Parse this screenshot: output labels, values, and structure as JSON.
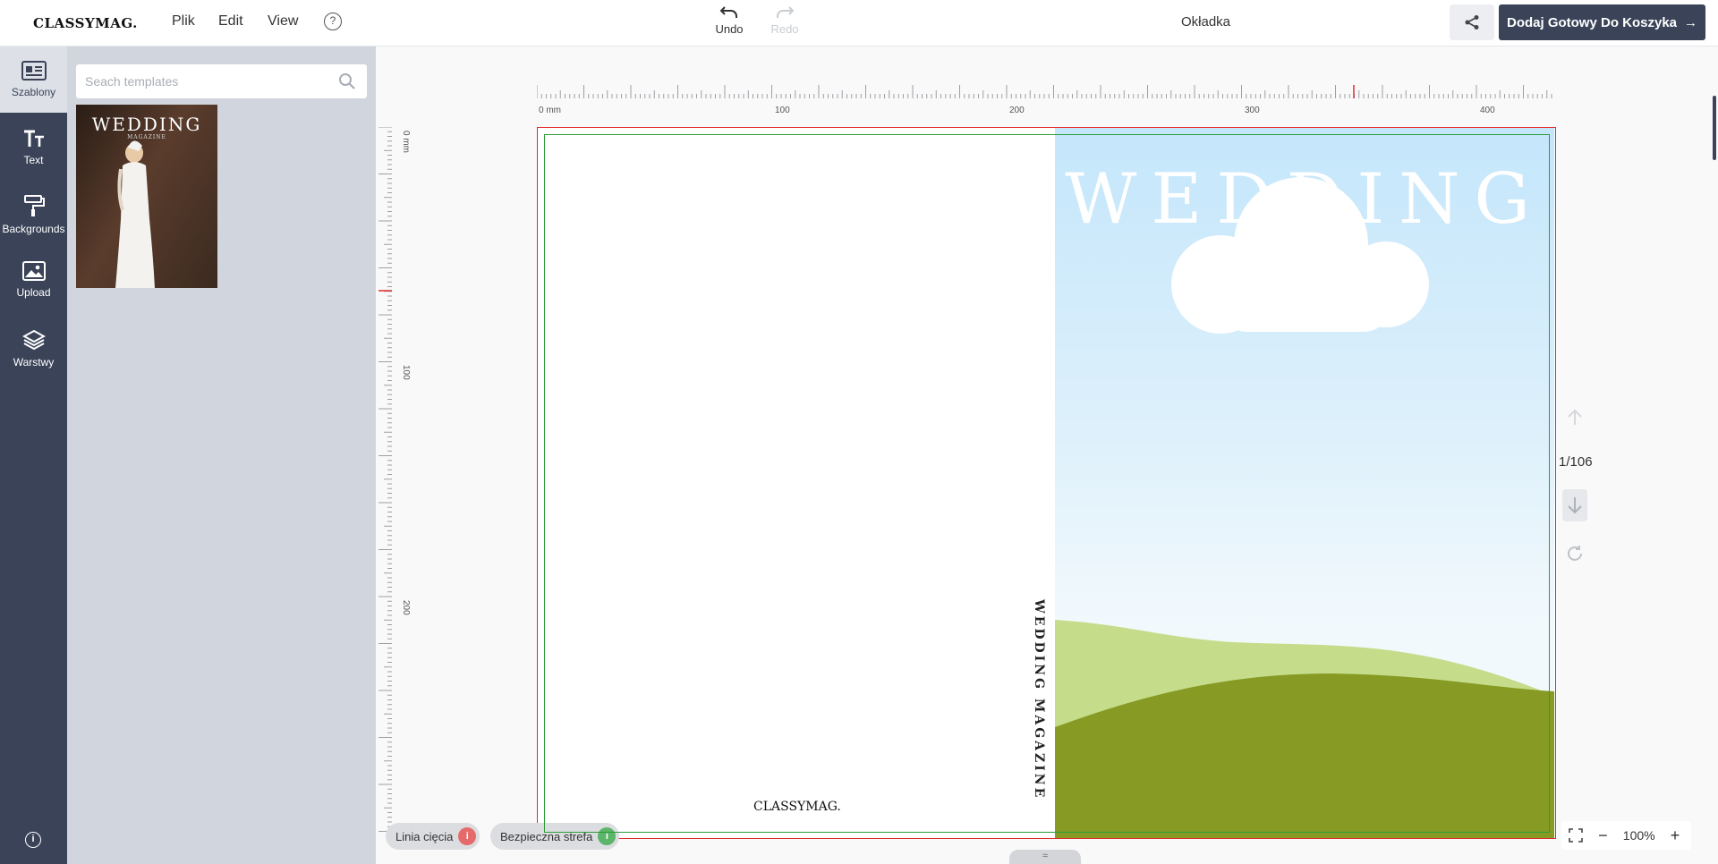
{
  "app": {
    "logo": "CLASSYMAG."
  },
  "menu": {
    "file": "Plik",
    "edit": "Edit",
    "view": "View",
    "help_glyph": "?"
  },
  "history": {
    "undo": "Undo",
    "redo": "Redo"
  },
  "document": {
    "title": "Okładka"
  },
  "actions": {
    "add_to_cart": "Dodaj Gotowy Do Koszyka",
    "add_to_cart_arrow": "→"
  },
  "sidebar": {
    "items": [
      {
        "label": "Szablony",
        "icon": "template-card-icon",
        "active": true
      },
      {
        "label": "Text",
        "icon": "text-icon",
        "active": false
      },
      {
        "label": "Backgrounds",
        "icon": "paint-roller-icon",
        "active": false
      },
      {
        "label": "Upload",
        "icon": "image-upload-icon",
        "active": false
      },
      {
        "label": "Warstwy",
        "icon": "layers-icon",
        "active": false
      }
    ],
    "info_glyph": "i"
  },
  "templates": {
    "search_placeholder": "Seach templates",
    "search_value": "",
    "items": [
      {
        "title": "WEDDING",
        "subtitle": "MAGAZINE"
      }
    ]
  },
  "rulers": {
    "horizontal": [
      "0 mm",
      "100",
      "200",
      "300",
      "400"
    ],
    "vertical": [
      "0 mm",
      "100",
      "200"
    ]
  },
  "canvas": {
    "back_logo": "CLASSYMAG.",
    "spine_text": "WEDDING MAGAZINE",
    "cover_title": "WEDDING",
    "colors": {
      "sky": "#c4e6fb",
      "hill_light": "#c5dd8a",
      "hill_dark": "#869a24",
      "bleed_line": "#e02c2c",
      "safe_line": "#2f9b3a"
    }
  },
  "pagination": {
    "counter": "1/106"
  },
  "guides": {
    "cut_line": "Linia cięcia",
    "safe_zone": "Bezpieczna strefa",
    "info_glyph": "i"
  },
  "zoom": {
    "value": "100%",
    "minus": "−",
    "plus": "+"
  },
  "handle": {
    "glyph": "≈"
  }
}
